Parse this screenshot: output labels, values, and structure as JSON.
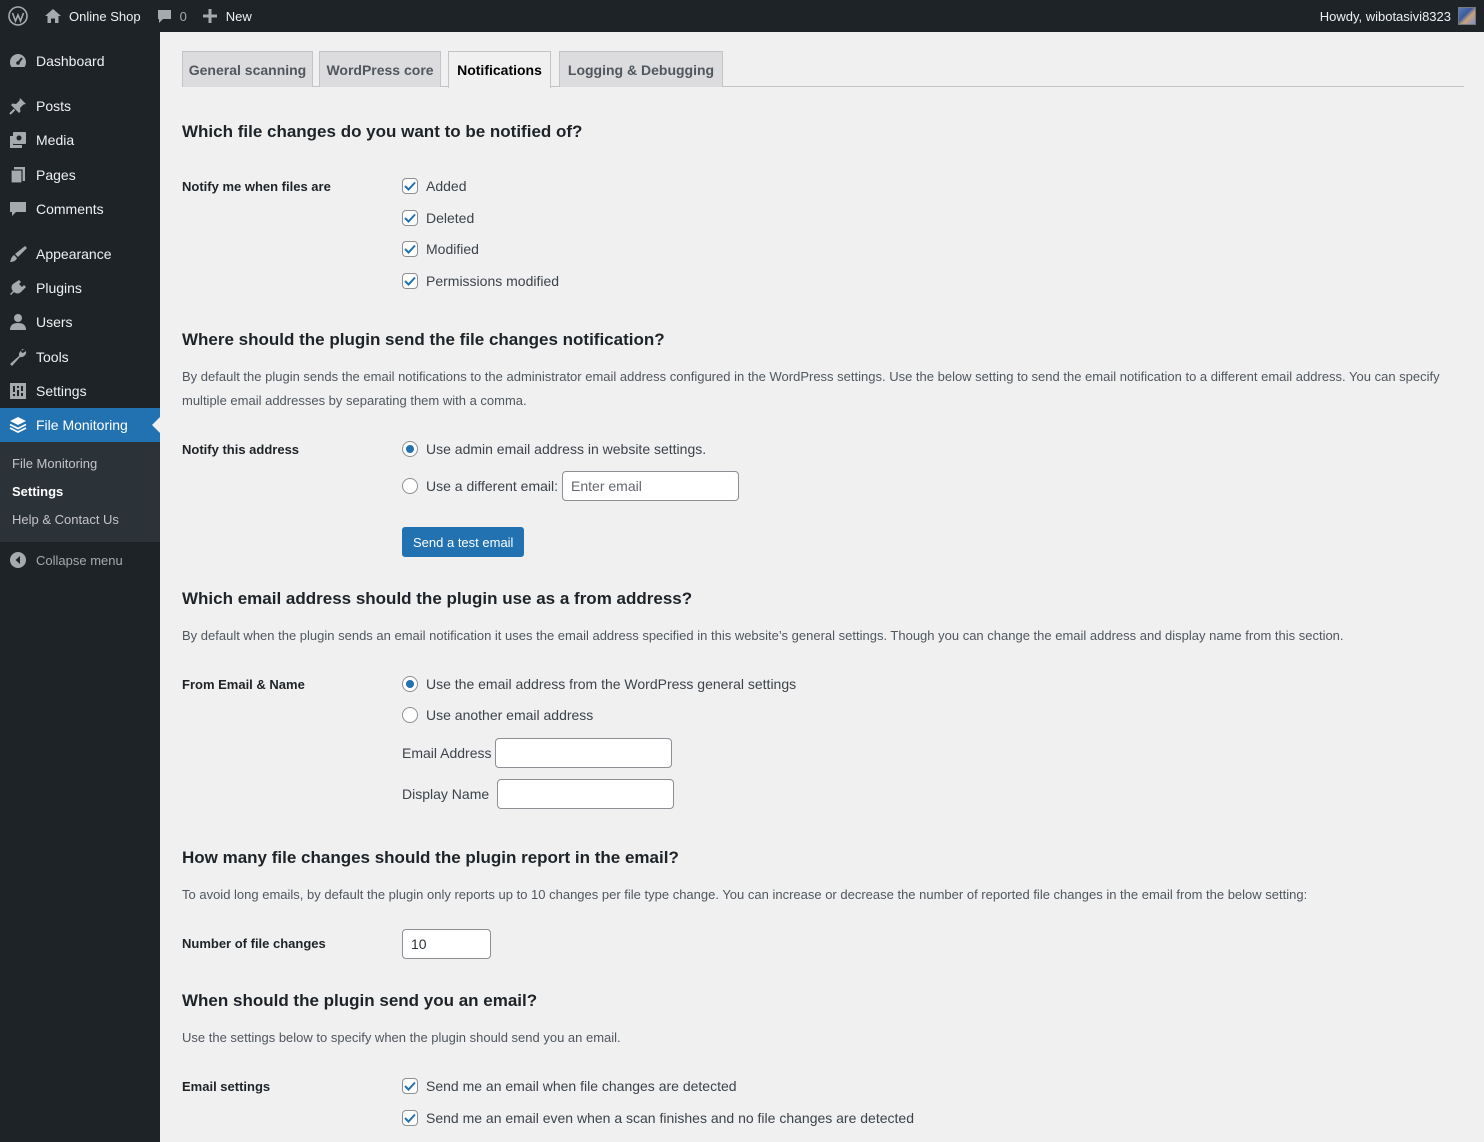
{
  "adminbar": {
    "site_name": "Online Shop",
    "comments_count": "0",
    "new_label": "New",
    "howdy": "Howdy, wibotasivi8323"
  },
  "sidebar": {
    "items": [
      {
        "label": "Dashboard",
        "icon": "dashboard-icon"
      },
      {
        "label": "Posts",
        "icon": "pin-icon"
      },
      {
        "label": "Media",
        "icon": "media-icon"
      },
      {
        "label": "Pages",
        "icon": "pages-icon"
      },
      {
        "label": "Comments",
        "icon": "comment-icon"
      },
      {
        "label": "Appearance",
        "icon": "paintbrush-icon"
      },
      {
        "label": "Plugins",
        "icon": "plugin-icon"
      },
      {
        "label": "Users",
        "icon": "user-icon"
      },
      {
        "label": "Tools",
        "icon": "wrench-icon"
      },
      {
        "label": "Settings",
        "icon": "sliders-icon"
      },
      {
        "label": "File Monitoring",
        "icon": "layers-icon"
      }
    ],
    "submenu": [
      "File Monitoring",
      "Settings",
      "Help & Contact Us"
    ],
    "collapse_label": "Collapse menu"
  },
  "tabs": [
    "General scanning",
    "WordPress core",
    "Notifications",
    "Logging & Debugging"
  ],
  "active_tab": "Notifications",
  "sections": {
    "notify_of": {
      "heading": "Which file changes do you want to be notified of?",
      "label": "Notify me when files are",
      "options": [
        "Added",
        "Deleted",
        "Modified",
        "Permissions modified"
      ]
    },
    "send_to": {
      "heading": "Where should the plugin send the file changes notification?",
      "description": "By default the plugin sends the email notifications to the administrator email address configured in the WordPress settings. Use the below setting to send the email notification to a different email address. You can specify multiple email addresses by separating them with a comma.",
      "label": "Notify this address",
      "option_admin": "Use admin email address in website settings.",
      "option_different": "Use a different email:",
      "email_placeholder": "Enter email",
      "test_button": "Send a test email"
    },
    "from_address": {
      "heading": "Which email address should the plugin use as a from address?",
      "description": "By default when the plugin sends an email notification it uses the email address specified in this website’s general settings. Though you can change the email address and display name from this section.",
      "label": "From Email & Name",
      "option_general": "Use the email address from the WordPress general settings",
      "option_another": "Use another email address",
      "email_label": "Email Address",
      "name_label": "Display Name"
    },
    "count": {
      "heading": "How many file changes should the plugin report in the email?",
      "description": "To avoid long emails, by default the plugin only reports up to 10 changes per file type change. You can increase or decrease the number of reported file changes in the email from the below setting:",
      "label": "Number of file changes",
      "value": "10"
    },
    "when": {
      "heading": "When should the plugin send you an email?",
      "description": "Use the settings below to specify when the plugin should send you an email.",
      "label": "Email settings",
      "options": [
        "Send me an email when file changes are detected",
        "Send me an email even when a scan finishes and no file changes are detected"
      ]
    }
  },
  "colors": {
    "accent": "#2271b1",
    "sidebar_bg": "#1d2327",
    "page_bg": "#f0f0f1"
  }
}
